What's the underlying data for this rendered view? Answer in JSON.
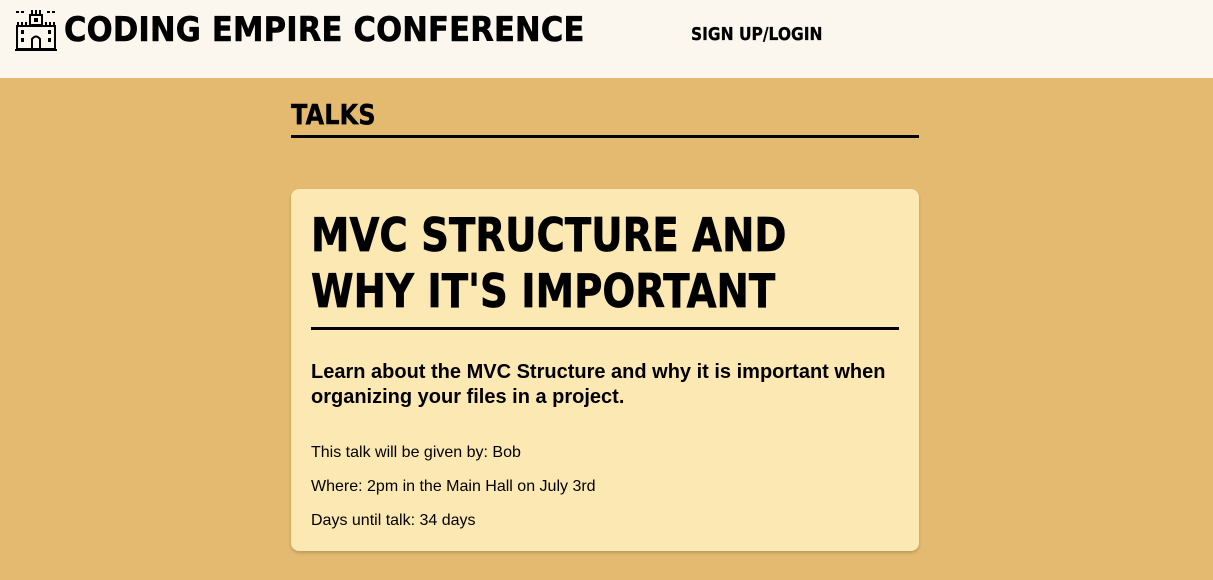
{
  "header": {
    "brand_title": "Coding Empire Conference",
    "brand_icon": "castle-icon",
    "nav_signup_login": "SIGN UP/LOGIN"
  },
  "colors": {
    "page_background": "#e4ba70",
    "header_background": "#fbf7ef",
    "card_background": "#fbe8b2",
    "text": "#000000"
  },
  "main": {
    "section_title": "Talks",
    "talks": [
      {
        "title": "MVC Structure and why it's important",
        "description": "Learn about the MVC Structure and why it is important when organizing your files in a project.",
        "speaker_line": "This talk will be given by: Bob",
        "where_line": "Where: 2pm in the Main Hall on July 3rd",
        "countdown_line": "Days until talk: 34 days"
      }
    ]
  }
}
